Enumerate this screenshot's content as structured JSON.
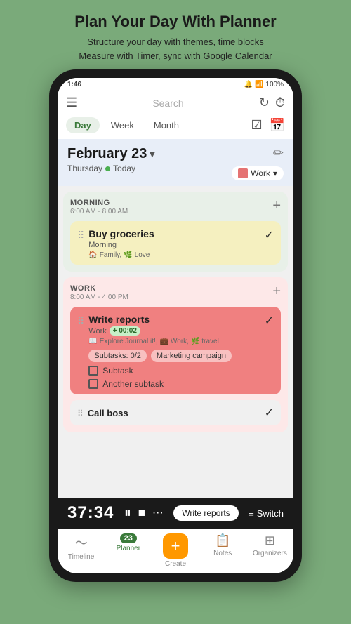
{
  "header": {
    "title": "Plan Your Day With Planner",
    "subtitle_line1": "Structure your day with themes, time blocks",
    "subtitle_line2": "Measure with Timer, sync with Google Calendar"
  },
  "status_bar": {
    "time": "1:46",
    "battery": "100%",
    "icons": "🔔 📡 📶"
  },
  "top_nav": {
    "search_placeholder": "Search",
    "refresh_icon": "↻",
    "timer_icon": "⏱"
  },
  "view_tabs": {
    "tabs": [
      {
        "label": "Day",
        "active": true
      },
      {
        "label": "Week",
        "active": false
      },
      {
        "label": "Month",
        "active": false
      }
    ],
    "checklist_icon": "☑",
    "calendar_icon": "📅"
  },
  "date_header": {
    "date": "February 23",
    "chevron": "▾",
    "day": "Thursday",
    "today_label": "Today",
    "edit_icon": "✏",
    "work_label": "Work",
    "work_chevron": "▾"
  },
  "morning_section": {
    "title": "MORNING",
    "time_range": "6:00 AM - 8:00 AM",
    "add_icon": "+",
    "task": {
      "title": "Buy groceries",
      "subtitle": "Morning",
      "tags": "Family, Love",
      "checked": true
    }
  },
  "work_section": {
    "title": "WORK",
    "time_range": "8:00 AM - 4:00 PM",
    "add_icon": "+",
    "task1": {
      "title": "Write reports",
      "meta_label": "Work",
      "timer": "+ 00:02",
      "tags": "Explore Journal it!, Work, travel",
      "subtasks_badge": "Subtasks: 0/2",
      "campaign_badge": "Marketing campaign",
      "subtask1": "Subtask",
      "subtask2": "Another subtask",
      "checked": true
    },
    "task2": {
      "title": "Call boss",
      "checked": true
    }
  },
  "timer_bar": {
    "time": "37:34",
    "pause_icon": "⏸",
    "stop_icon": "⏹",
    "dots_icon": "···",
    "label": "Write reports",
    "switch_label": "Switch",
    "switch_icon": "≡"
  },
  "bottom_nav": {
    "items": [
      {
        "label": "Timeline",
        "icon": "〜",
        "active": false
      },
      {
        "label": "Planner",
        "badge": "23",
        "active": true
      },
      {
        "label": "Create",
        "icon": "+",
        "active": false
      },
      {
        "label": "Notes",
        "icon": "📋",
        "active": false
      },
      {
        "label": "Organizers",
        "icon": "⊞",
        "active": false
      }
    ]
  }
}
